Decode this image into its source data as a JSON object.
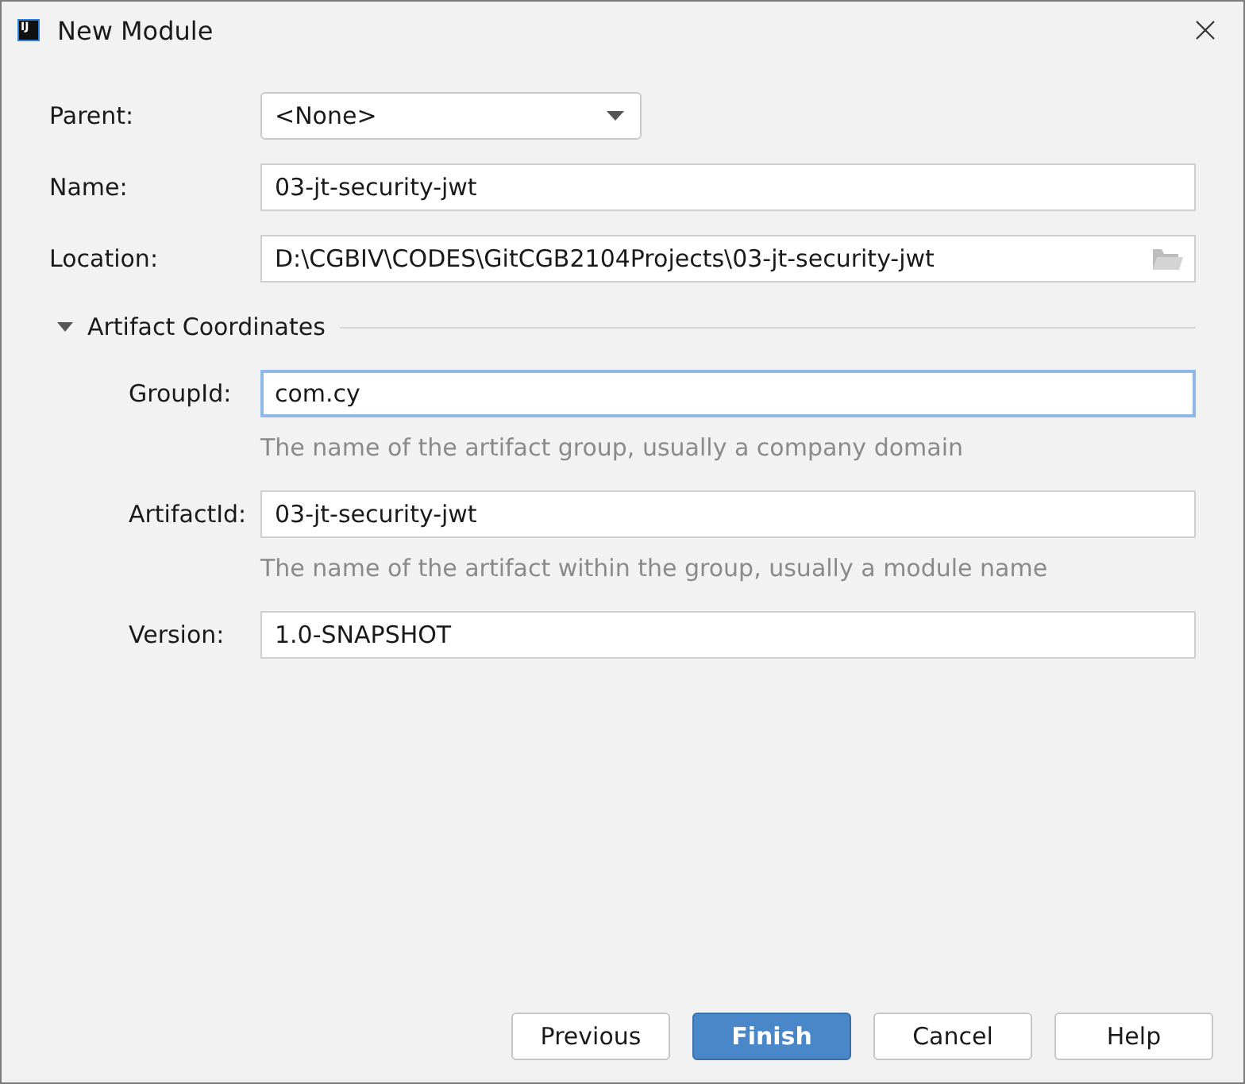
{
  "window": {
    "title": "New Module",
    "logo_text": "IJ"
  },
  "fields": [
    {
      "kind": "dropdown",
      "label": "Parent:",
      "value": "<None>"
    },
    {
      "kind": "text",
      "label": "Name:",
      "value": "03-jt-security-jwt"
    },
    {
      "kind": "path",
      "label": "Location:",
      "value": "D:\\CGBIV\\CODES\\GitCGB2104Projects\\03-jt-security-jwt"
    }
  ],
  "section": {
    "title": "Artifact Coordinates",
    "expanded": true,
    "fields": [
      {
        "label": "GroupId:",
        "value": "com.cy",
        "focused": true,
        "hint": "The name of the artifact group, usually a company domain"
      },
      {
        "label": "ArtifactId:",
        "value": "03-jt-security-jwt",
        "focused": false,
        "hint": "The name of the artifact within the group, usually a module name"
      },
      {
        "label": "Version:",
        "value": "1.0-SNAPSHOT",
        "focused": false
      }
    ]
  },
  "buttons": [
    {
      "label": "Previous",
      "default": false
    },
    {
      "label": "Finish",
      "default": true
    },
    {
      "label": "Cancel",
      "default": false
    },
    {
      "label": "Help",
      "default": false
    }
  ]
}
